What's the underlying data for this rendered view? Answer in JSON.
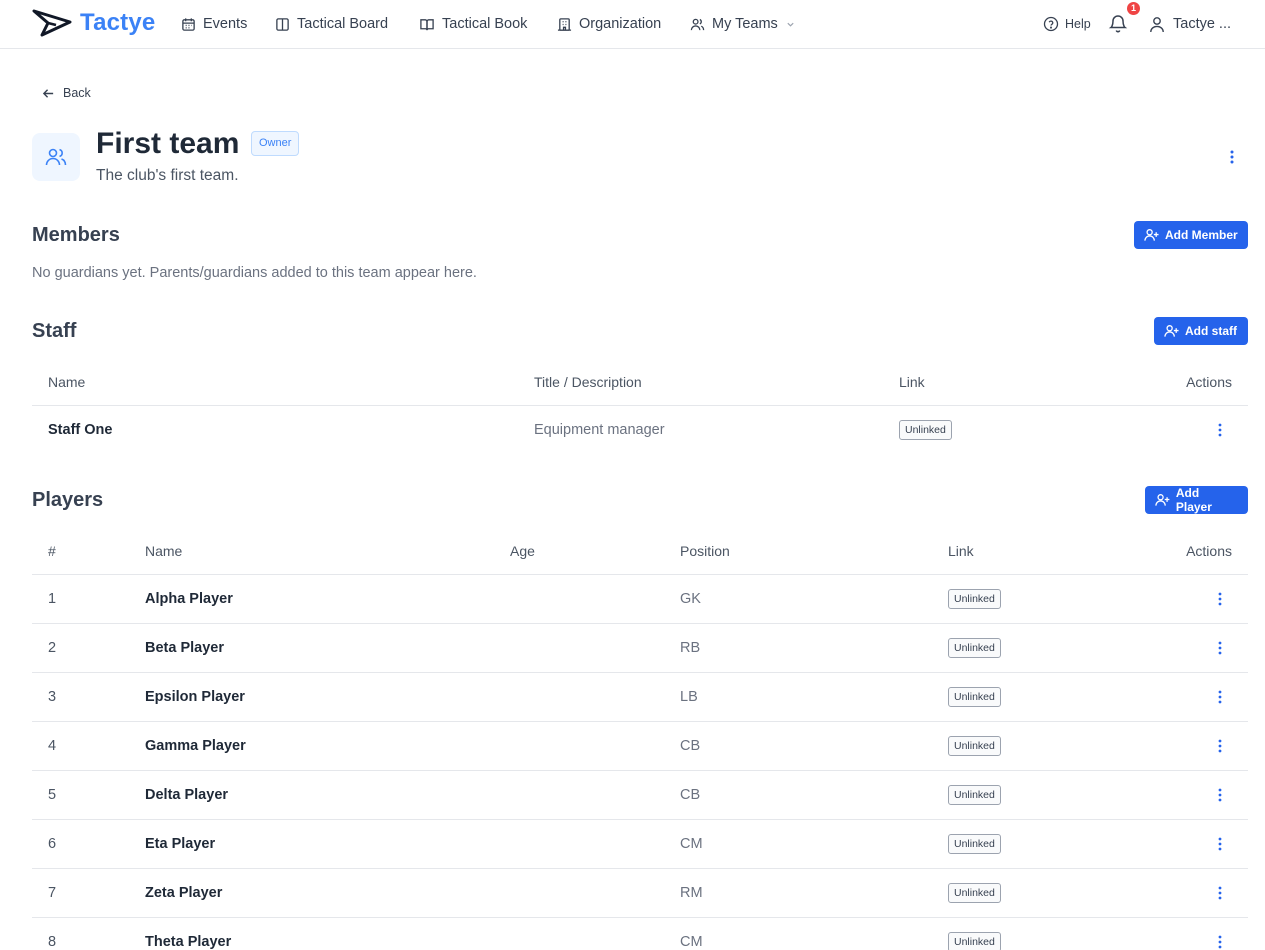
{
  "brand": {
    "name": "Tactye",
    "color": "#3b82f6"
  },
  "nav": {
    "items": [
      {
        "label": "Events",
        "icon": "calendar-icon"
      },
      {
        "label": "Tactical Board",
        "icon": "board-icon"
      },
      {
        "label": "Tactical Book",
        "icon": "book-icon"
      },
      {
        "label": "Organization",
        "icon": "building-icon"
      },
      {
        "label": "My Teams",
        "icon": "users-icon"
      }
    ],
    "help_label": "Help",
    "notification_count": "1",
    "user_label": "Tactye ..."
  },
  "back_label": "Back",
  "team": {
    "name": "First team",
    "role_badge": "Owner",
    "description": "The club's first team."
  },
  "members": {
    "title": "Members",
    "add_label": "Add Member",
    "empty_text": "No guardians yet. Parents/guardians added to this team appear here."
  },
  "staff": {
    "title": "Staff",
    "add_label": "Add staff",
    "columns": [
      "Name",
      "Title / Description",
      "Link",
      "Actions"
    ],
    "rows": [
      {
        "name": "Staff One",
        "title": "Equipment manager",
        "link": "Unlinked"
      }
    ]
  },
  "players": {
    "title": "Players",
    "add_label": "Add Player",
    "columns": [
      "#",
      "Name",
      "Age",
      "Position",
      "Link",
      "Actions"
    ],
    "rows": [
      {
        "number": "1",
        "name": "Alpha Player",
        "age": "",
        "position": "GK",
        "link": "Unlinked"
      },
      {
        "number": "2",
        "name": "Beta Player",
        "age": "",
        "position": "RB",
        "link": "Unlinked"
      },
      {
        "number": "3",
        "name": "Epsilon Player",
        "age": "",
        "position": "LB",
        "link": "Unlinked"
      },
      {
        "number": "4",
        "name": "Gamma Player",
        "age": "",
        "position": "CB",
        "link": "Unlinked"
      },
      {
        "number": "5",
        "name": "Delta Player",
        "age": "",
        "position": "CB",
        "link": "Unlinked"
      },
      {
        "number": "6",
        "name": "Eta Player",
        "age": "",
        "position": "CM",
        "link": "Unlinked"
      },
      {
        "number": "7",
        "name": "Zeta Player",
        "age": "",
        "position": "RM",
        "link": "Unlinked"
      },
      {
        "number": "8",
        "name": "Theta Player",
        "age": "",
        "position": "CM",
        "link": "Unlinked"
      }
    ]
  },
  "colors": {
    "primary": "#2563eb",
    "badge_red": "#ef4444"
  }
}
